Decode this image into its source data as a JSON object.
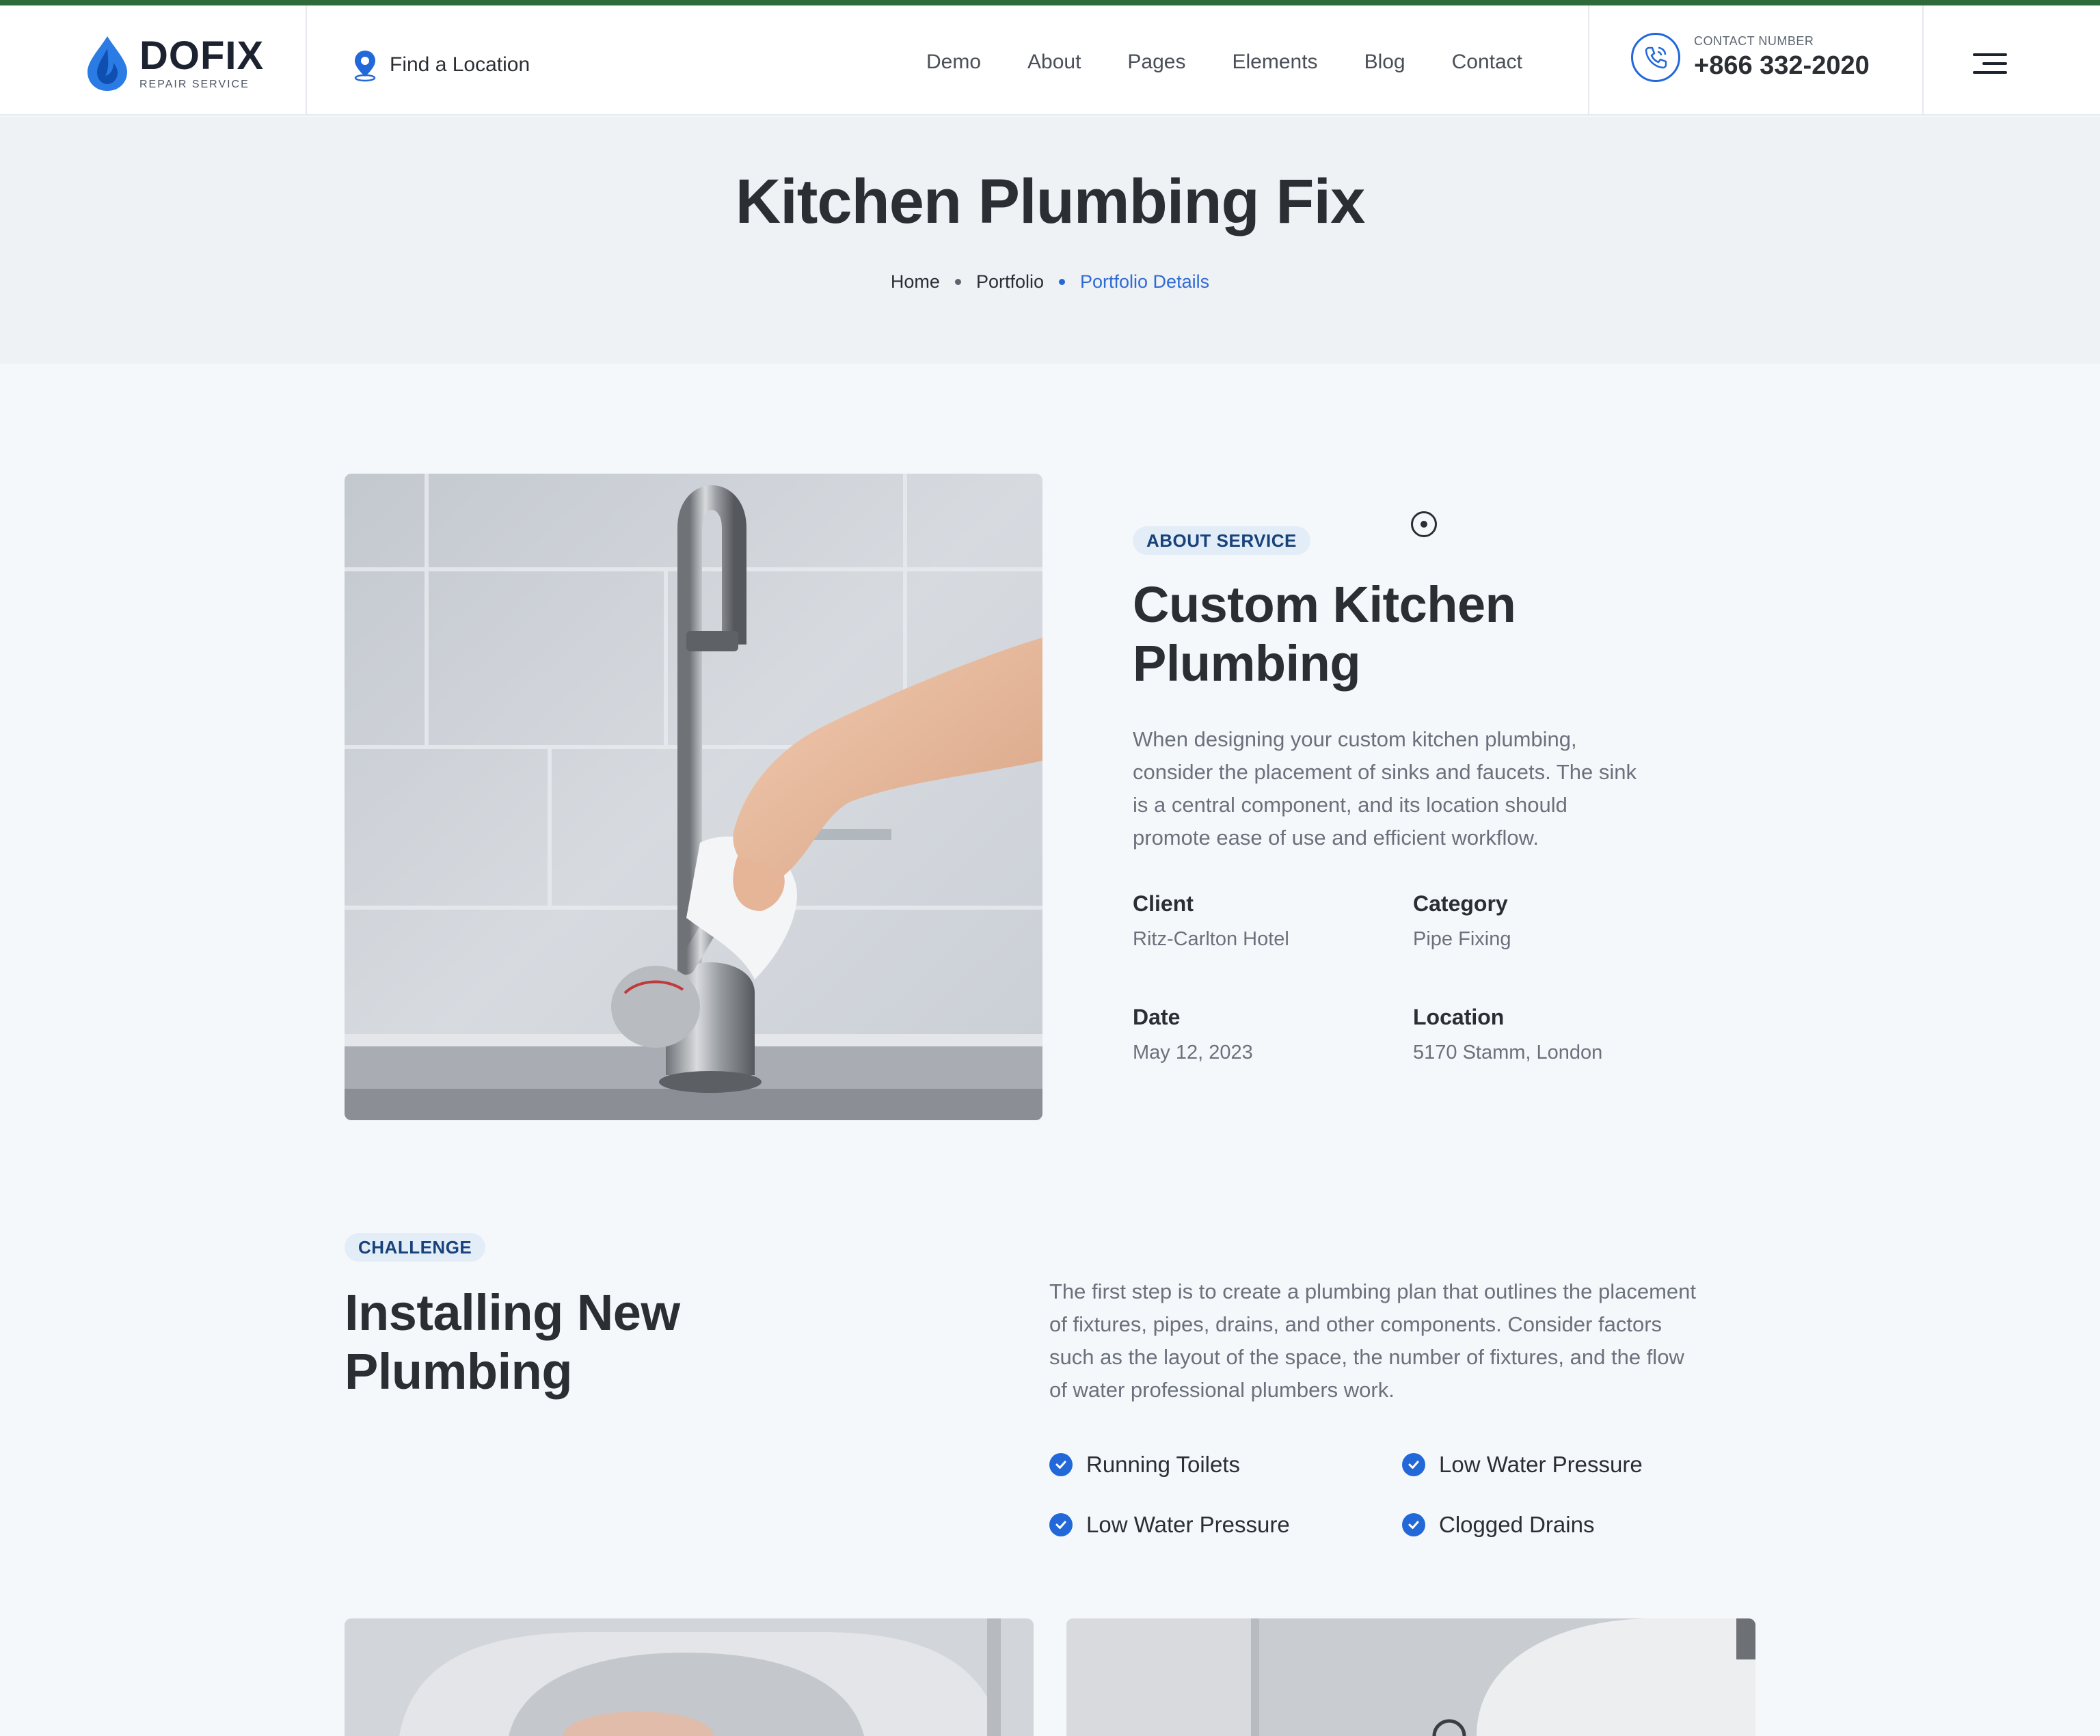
{
  "header": {
    "logo_name": "DOFIX",
    "logo_sub": "REPAIR SERVICE",
    "find_location": "Find a Location",
    "nav": [
      "Demo",
      "About",
      "Pages",
      "Elements",
      "Blog",
      "Contact"
    ],
    "contact_label": "CONTACT NUMBER",
    "contact_number": "+866 332-2020"
  },
  "hero": {
    "title": "Kitchen Plumbing Fix",
    "breadcrumb": [
      "Home",
      "Portfolio",
      "Portfolio Details"
    ]
  },
  "about": {
    "tag": "ABOUT SERVICE",
    "title_line1": "Custom Kitchen",
    "title_line2": "Plumbing",
    "para_lines": [
      "When designing your custom kitchen plumbing,",
      "consider the placement of sinks and faucets. The sink",
      "is a central component, and its location should",
      "promote ease of use and efficient workflow."
    ],
    "meta": {
      "client_label": "Client",
      "client_value": "Ritz-Carlton Hotel",
      "category_label": "Category",
      "category_value": "Pipe Fixing",
      "date_label": "Date",
      "date_value": "May 12, 2023",
      "location_label": "Location",
      "location_value": "5170 Stamm, London"
    }
  },
  "challenge": {
    "tag": "CHALLENGE",
    "title_line1": "Installing New",
    "title_line2": "Plumbing",
    "para_lines": [
      "The first step is to create a plumbing plan that outlines the placement",
      "of fixtures, pipes, drains, and other components. Consider factors",
      "such as the layout of the space, the number of fixtures, and the flow",
      "of water professional plumbers work."
    ],
    "checklist": [
      "Running Toilets",
      "Low Water Pressure",
      "Low Water Pressure",
      "Clogged Drains"
    ]
  },
  "colors": {
    "accent": "#2368d8",
    "top_line": "#2f6a3a",
    "heading": "#2b2e33",
    "body_text": "#6b717c",
    "tag_bg": "#e3edf8"
  }
}
